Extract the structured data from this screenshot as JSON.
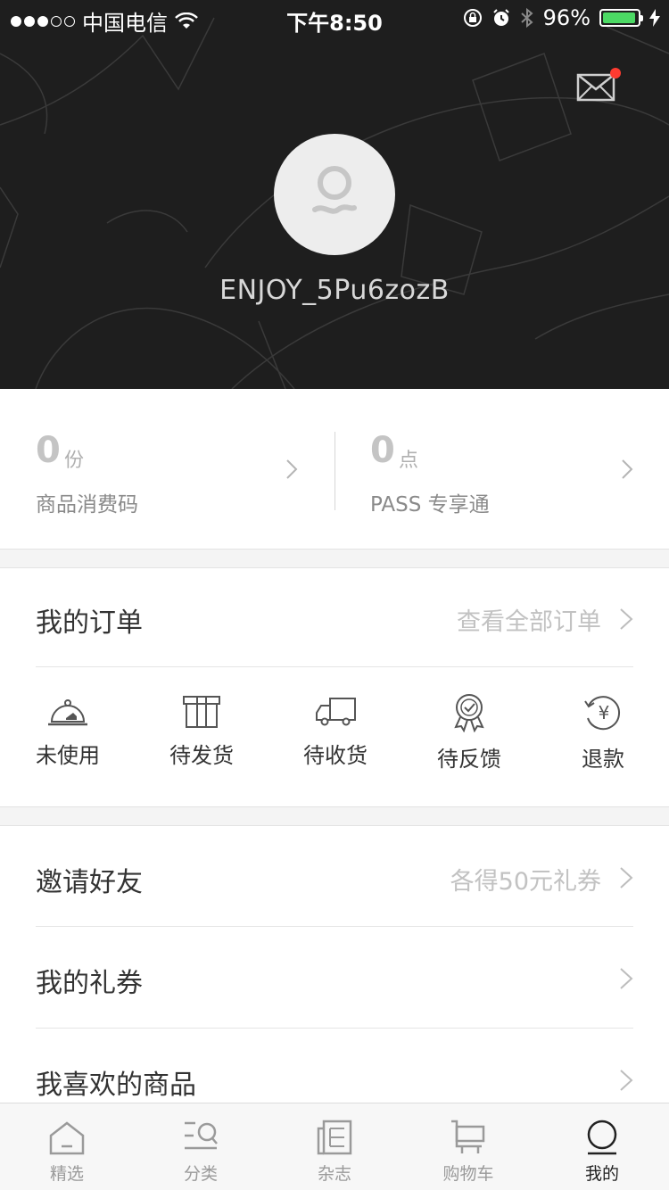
{
  "status_bar": {
    "carrier": "中国电信",
    "time": "下午8:50",
    "battery": "96%",
    "battery_level": 0.96
  },
  "header": {
    "username": "ENJOY_5Pu6zozB",
    "mail_has_badge": true
  },
  "stats": [
    {
      "value": "0",
      "unit": "份",
      "label": "商品消费码"
    },
    {
      "value": "0",
      "unit": "点",
      "label": "PASS 专享通"
    }
  ],
  "orders": {
    "title": "我的订单",
    "view_all": "查看全部订单",
    "items": [
      {
        "label": "未使用",
        "icon": "cloche-icon"
      },
      {
        "label": "待发货",
        "icon": "gift-box-icon"
      },
      {
        "label": "待收货",
        "icon": "delivery-truck-icon"
      },
      {
        "label": "待反馈",
        "icon": "medal-icon"
      },
      {
        "label": "退款",
        "icon": "refund-yen-icon"
      }
    ]
  },
  "list": [
    {
      "title": "邀请好友",
      "sub": "各得50元礼券"
    },
    {
      "title": "我的礼券",
      "sub": ""
    },
    {
      "title": "我喜欢的商品",
      "sub": ""
    }
  ],
  "tabs": [
    {
      "label": "精选",
      "icon": "home-icon"
    },
    {
      "label": "分类",
      "icon": "category-search-icon"
    },
    {
      "label": "杂志",
      "icon": "magazine-icon"
    },
    {
      "label": "购物车",
      "icon": "cart-icon"
    },
    {
      "label": "我的",
      "icon": "profile-icon",
      "active": true
    }
  ],
  "colors": {
    "header_bg": "#1e1e1e",
    "battery_green": "#4cd964",
    "badge_red": "#ff3b30",
    "muted_text": "#c2c2c2"
  }
}
